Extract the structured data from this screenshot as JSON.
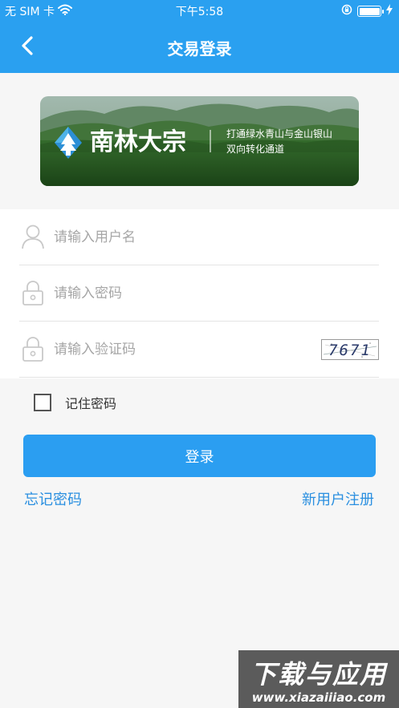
{
  "status_bar": {
    "carrier": "无 SIM 卡",
    "time": "下午5:58",
    "battery_level": 1.0
  },
  "nav": {
    "title": "交易登录",
    "back_icon": "chevron-left-icon"
  },
  "banner": {
    "brand": "南林大宗",
    "tagline_line1": "打通绿水青山与金山银山",
    "tagline_line2": "双向转化通道"
  },
  "form": {
    "username_placeholder": "请输入用户名",
    "password_placeholder": "请输入密码",
    "captcha_placeholder": "请输入验证码",
    "captcha_text": "7671"
  },
  "remember": {
    "label": "记住密码",
    "checked": false
  },
  "login_button": "登录",
  "links": {
    "forgot": "忘记密码",
    "register": "新用户注册"
  },
  "watermark": {
    "main": "下载与应用",
    "url": "www.xiazaiiiao.com"
  },
  "colors": {
    "primary": "#2aa0f0",
    "link": "#2a8fe0",
    "background": "#f6f6f6"
  }
}
